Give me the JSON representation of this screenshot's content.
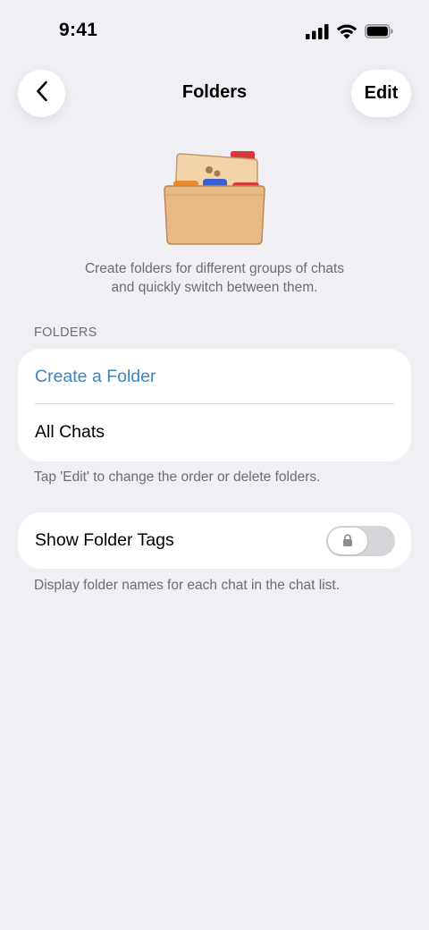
{
  "status_bar": {
    "time": "9:41"
  },
  "nav": {
    "title": "Folders",
    "edit_label": "Edit"
  },
  "intro": {
    "line1": "Create folders for different groups of chats",
    "line2": "and quickly switch between them."
  },
  "folders_section": {
    "header": "FOLDERS",
    "rows": [
      {
        "label": "Create a Folder"
      },
      {
        "label": "All Chats"
      }
    ],
    "footer": "Tap 'Edit' to change the order or delete folders."
  },
  "tags_section": {
    "label": "Show Folder Tags",
    "toggle_on": false,
    "toggle_locked": true,
    "footer": "Display folder names for each chat in the chat list."
  },
  "colors": {
    "accent": "#3a85c6",
    "background": "#efeff4",
    "secondary_text": "#6d6d72"
  }
}
